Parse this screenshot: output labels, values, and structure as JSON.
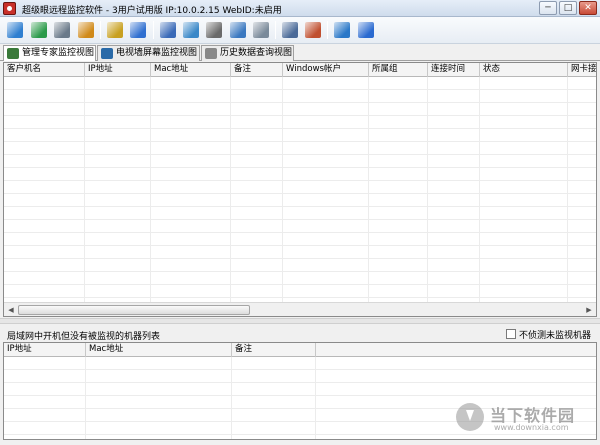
{
  "window": {
    "title": "超级眼远程监控软件 - 3用户试用版 IP:10.0.2.15 WebID:未启用",
    "buttons": {
      "minimize": "─",
      "maximize": "□",
      "close": "✕"
    }
  },
  "toolbar": {
    "buttons": [
      {
        "name": "toolbar-button-1",
        "icon": "folder-icon",
        "color": "#2f7fd0"
      },
      {
        "name": "toolbar-button-2",
        "icon": "globe-icon",
        "color": "#2a9a4a"
      },
      {
        "name": "toolbar-button-3",
        "icon": "gear-icon",
        "color": "#6a7a8a"
      },
      {
        "name": "toolbar-button-4",
        "icon": "users-icon",
        "color": "#d08a1a"
      },
      {
        "name": "toolbar-button-5",
        "icon": "key-icon",
        "color": "#c8a020"
      },
      {
        "name": "toolbar-button-6",
        "icon": "pin-icon",
        "color": "#2f6fd0"
      },
      {
        "name": "toolbar-button-7",
        "icon": "monitor-icon",
        "color": "#3a6ab8"
      },
      {
        "name": "toolbar-button-8",
        "icon": "mail-icon",
        "color": "#3a88c8"
      },
      {
        "name": "toolbar-button-9",
        "icon": "camera-icon",
        "color": "#6a6a6a"
      },
      {
        "name": "toolbar-button-10",
        "icon": "windows-icon",
        "color": "#3a78c0"
      },
      {
        "name": "toolbar-button-11",
        "icon": "disk-icon",
        "color": "#7a8a9a"
      },
      {
        "name": "toolbar-button-12",
        "icon": "server-icon",
        "color": "#4a6a98"
      },
      {
        "name": "toolbar-button-13",
        "icon": "print-icon",
        "color": "#c05030"
      },
      {
        "name": "toolbar-button-14",
        "icon": "cart-icon",
        "color": "#2a78c8"
      },
      {
        "name": "toolbar-button-15",
        "icon": "help-icon",
        "color": "#2a6ad0"
      }
    ]
  },
  "tabs": [
    {
      "label": "管理专家监控视图",
      "icon": "people-icon",
      "color": "#3a7a3a"
    },
    {
      "label": "电视墙屏幕监控视图",
      "icon": "tv-wall-icon",
      "color": "#2a6aa8"
    },
    {
      "label": "历史数据查询视图",
      "icon": "notepad-icon",
      "color": "#888888"
    }
  ],
  "main_table": {
    "columns": [
      "客户机名",
      "IP地址",
      "Mac地址",
      "备注",
      "Windows帐户",
      "所属组",
      "连接时间",
      "状态",
      "网卡接"
    ]
  },
  "lower_panel": {
    "title": "局域网中开机但没有被监视的机器列表",
    "checkbox_label": "不侦测未监视机器",
    "columns": [
      "IP地址",
      "Mac地址",
      "备注"
    ]
  },
  "watermark": {
    "name": "当下软件园",
    "url": "www.downxia.com"
  }
}
